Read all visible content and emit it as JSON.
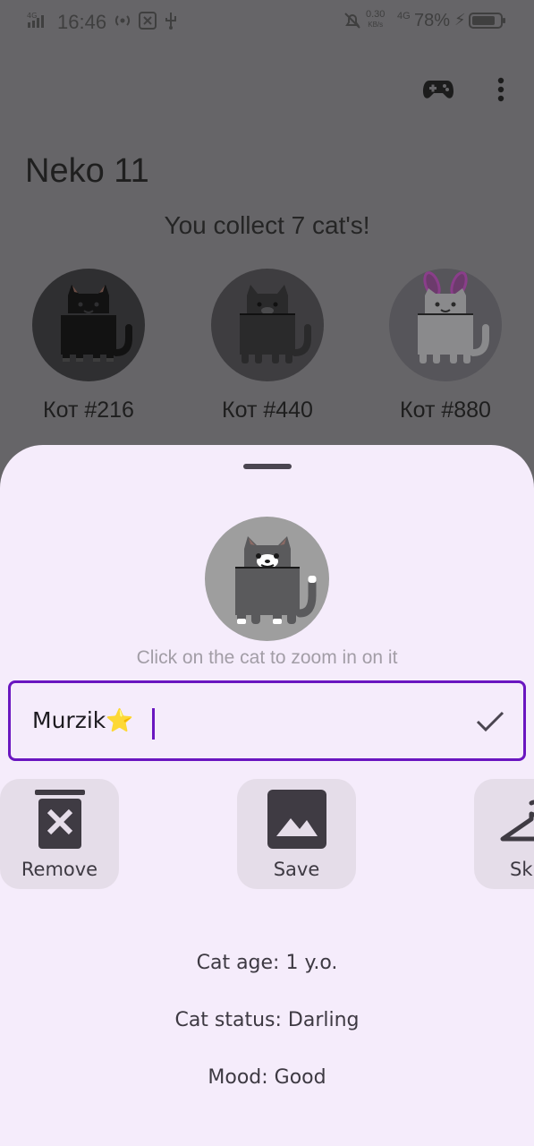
{
  "status_bar": {
    "time": "16:46",
    "network_speed_value": "0.30",
    "network_speed_unit": "KB/s",
    "network_type": "4G",
    "battery_percent": "78%",
    "battery_level": 0.78
  },
  "app": {
    "title": "Neko 11",
    "collect_message": "You collect 7 cat's!",
    "cats": [
      {
        "name": "Кот #216"
      },
      {
        "name": "Кот #440"
      },
      {
        "name": "Кот #880"
      }
    ]
  },
  "sheet": {
    "hint": "Click on the cat to zoom in on it",
    "name_value": "Murzik⭐",
    "actions": {
      "remove_label": "Remove",
      "save_label": "Save",
      "skin_label": "Ski"
    },
    "info": {
      "age": "Cat age: 1 y.o.",
      "status": "Cat status: Darling",
      "mood": "Mood: Good"
    }
  },
  "colors": {
    "accent": "#6a16c0",
    "sheet_bg": "#f5ecfb",
    "scrim_bg": "#666568",
    "action_bg": "#e5dde9"
  }
}
